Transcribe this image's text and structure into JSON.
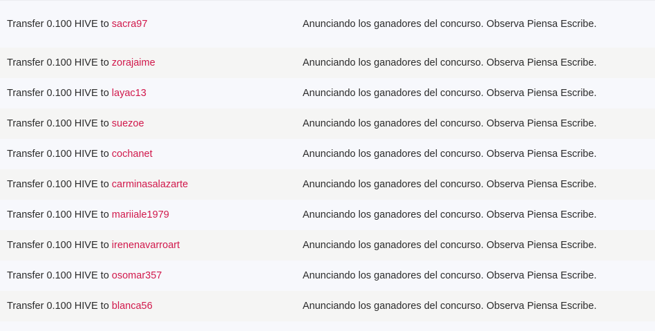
{
  "rows": [
    {
      "prefix": "Transfer 0.100 HIVE to",
      "user": "sacra97",
      "memo": "Anunciando los ganadores del concurso. Observa Piensa Escribe."
    },
    {
      "prefix": "Transfer 0.100 HIVE to",
      "user": "zorajaime",
      "memo": "Anunciando los ganadores del concurso. Observa Piensa Escribe."
    },
    {
      "prefix": "Transfer 0.100 HIVE to",
      "user": "layac13",
      "memo": "Anunciando los ganadores del concurso. Observa Piensa Escribe."
    },
    {
      "prefix": "Transfer 0.100 HIVE to",
      "user": "suezoe",
      "memo": "Anunciando los ganadores del concurso. Observa Piensa Escribe."
    },
    {
      "prefix": "Transfer 0.100 HIVE to",
      "user": "cochanet",
      "memo": "Anunciando los ganadores del concurso. Observa Piensa Escribe."
    },
    {
      "prefix": "Transfer 0.100 HIVE to",
      "user": "carminasalazarte",
      "memo": "Anunciando los ganadores del concurso. Observa Piensa Escribe."
    },
    {
      "prefix": "Transfer 0.100 HIVE to",
      "user": "mariiale1979",
      "memo": "Anunciando los ganadores del concurso. Observa Piensa Escribe."
    },
    {
      "prefix": "Transfer 0.100 HIVE to",
      "user": "irenenavarroart",
      "memo": "Anunciando los ganadores del concurso. Observa Piensa Escribe."
    },
    {
      "prefix": "Transfer 0.100 HIVE to",
      "user": "osomar357",
      "memo": "Anunciando los ganadores del concurso. Observa Piensa Escribe."
    },
    {
      "prefix": "Transfer 0.100 HIVE to",
      "user": "blanca56",
      "memo": "Anunciando los ganadores del concurso. Observa Piensa Escribe."
    }
  ]
}
